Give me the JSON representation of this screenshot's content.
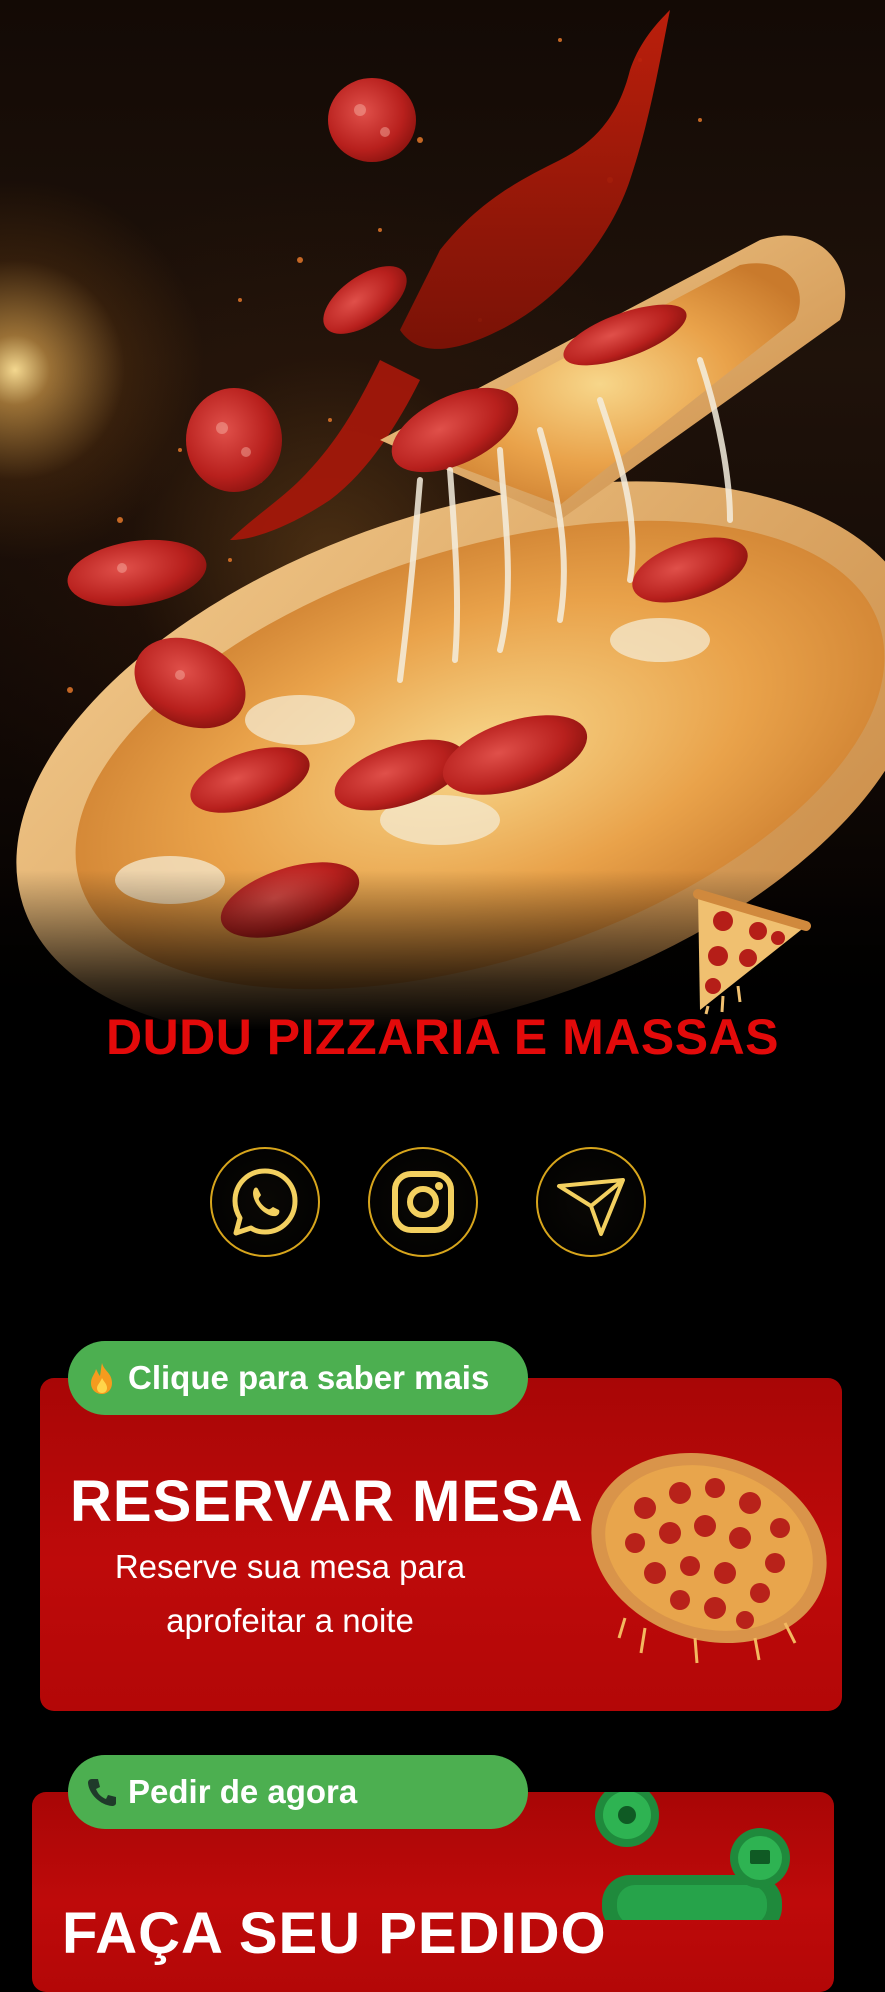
{
  "brand": {
    "name": "DUDU PIZZARIA E MASSAS"
  },
  "social": {
    "items": [
      {
        "name": "whatsapp-icon"
      },
      {
        "name": "instagram-icon"
      },
      {
        "name": "send-icon"
      }
    ],
    "accent_color": "#d7a51c"
  },
  "cards": [
    {
      "badge_icon": "fire-icon",
      "badge_label": "Clique para saber mais",
      "title": "RESERVAR MESA",
      "subtitle": "Reserve sua mesa para aprofeitar a noite"
    },
    {
      "badge_icon": "phone-icon",
      "badge_label": "Pedir de agora",
      "title": "FAÇA SEU PEDIDO"
    }
  ],
  "colors": {
    "brand_red": "#e30a0a",
    "card_red": "#b30707",
    "badge_green": "#4caf50",
    "background": "#000000"
  }
}
